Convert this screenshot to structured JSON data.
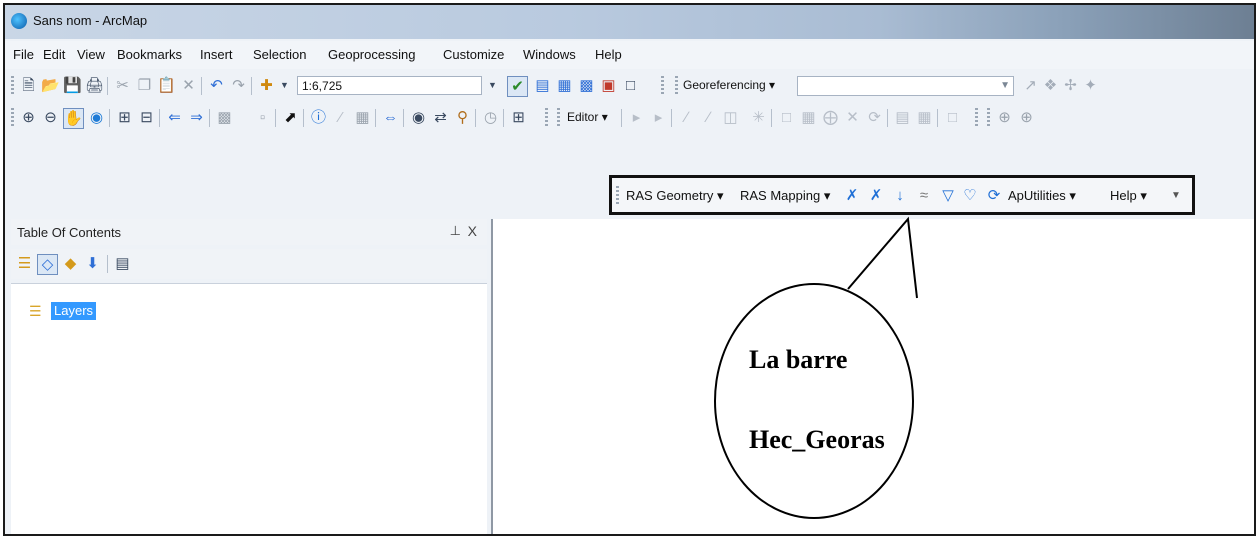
{
  "window": {
    "title": "Sans nom - ArcMap",
    "app_icon": "arcmap-globe-icon"
  },
  "menu": [
    "File",
    "Edit",
    "View",
    "Bookmarks",
    "Insert",
    "Selection",
    "Geoprocessing",
    "Customize",
    "Windows",
    "Help"
  ],
  "standard_toolbar": {
    "scale": "1:6,725",
    "georeferencing_label": "Georeferencing",
    "georeferencing_layer_value": ""
  },
  "tools_toolbar": {
    "editor_label": "Editor"
  },
  "hec_georas_toolbar": {
    "ras_geometry": "RAS Geometry",
    "ras_mapping": "RAS Mapping",
    "aputilities": "ApUtilities",
    "help": "Help"
  },
  "toc": {
    "title": "Table Of Contents",
    "pin": "⊥",
    "close": "X",
    "root_layer": "Layers"
  },
  "callout": {
    "line1": "La barre",
    "line2": "Hec_Georas"
  },
  "colors": {
    "selection": "#3399ff",
    "accent_blue": "#2f6fd6"
  }
}
